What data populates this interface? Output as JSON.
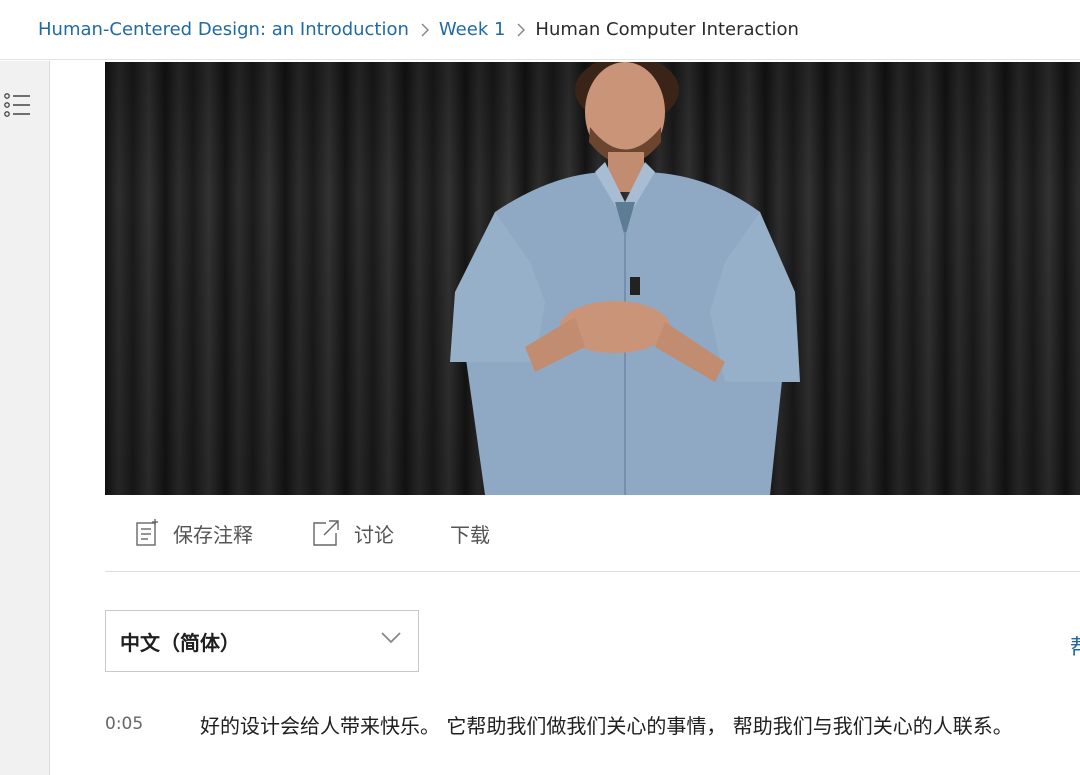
{
  "breadcrumb": {
    "course": "Human-Centered Design: an Introduction",
    "week": "Week 1",
    "current": "Human Computer Interaction"
  },
  "sidebar": {
    "menu_icon": "list-icon"
  },
  "video": {
    "description_icon": "video-player"
  },
  "actions": {
    "save_notes": "保存注释",
    "discuss": "讨论",
    "download": "下载"
  },
  "language": {
    "selected": "中文（简体）"
  },
  "right_edge_text": "帮",
  "transcript": {
    "timestamp": "0:05",
    "text": "好的设计会给人带来快乐。 它帮助我们做我们关心的事情， 帮助我们与我们关心的人联系。"
  },
  "colors": {
    "link": "#1f6aa5",
    "rail": "#f1f1f1",
    "text": "#1f1f1f"
  }
}
